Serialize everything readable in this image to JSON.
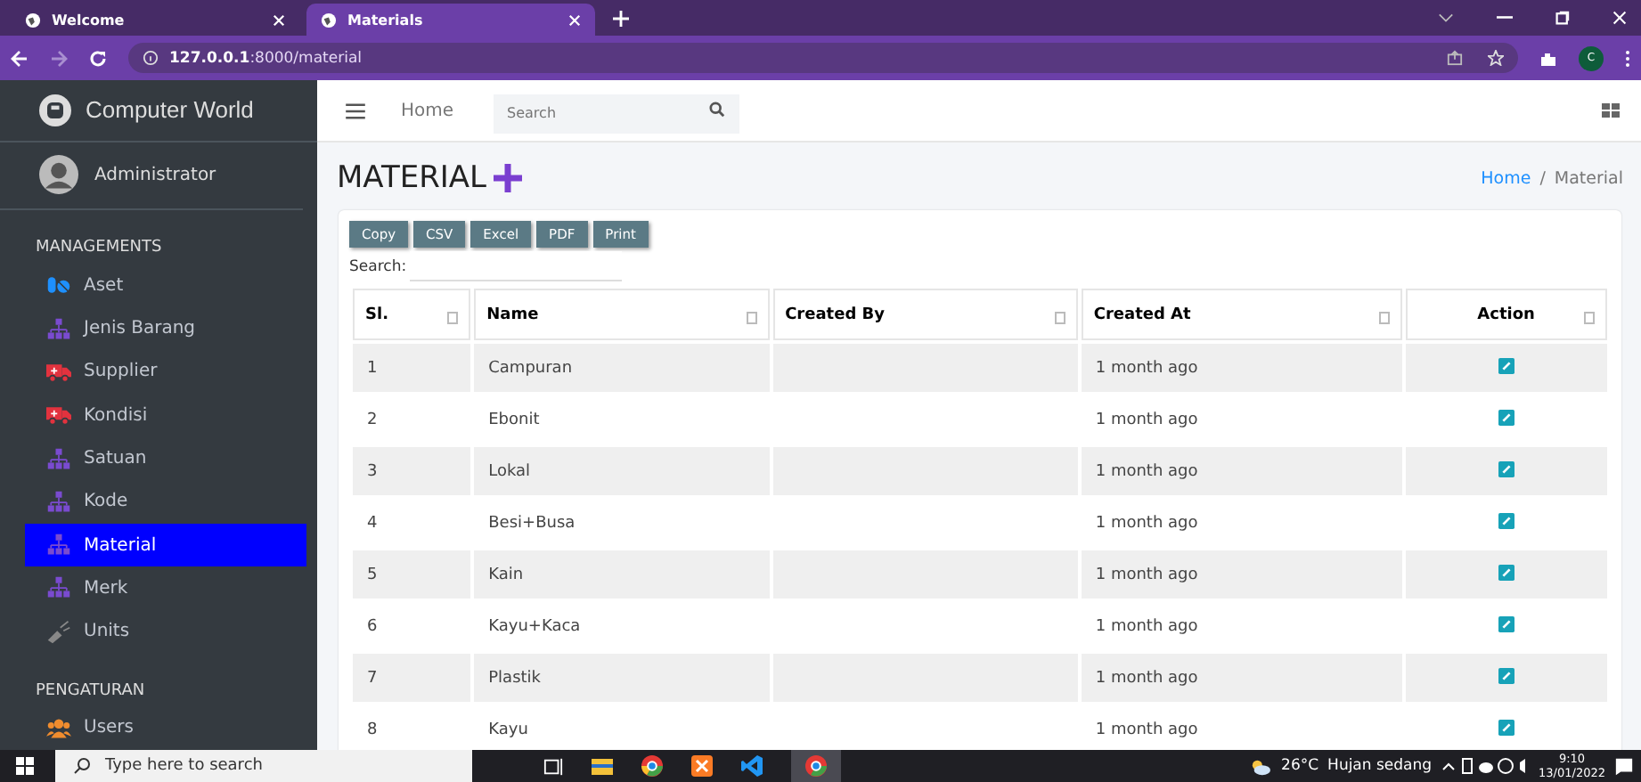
{
  "browser": {
    "tabs": [
      {
        "title": "Welcome",
        "selected": false
      },
      {
        "title": "Materials",
        "selected": true
      }
    ],
    "url": "**127.0.0.1**:8000/material",
    "profile": "C"
  },
  "sidebar": {
    "brand": "Computer World",
    "user": "Administrator",
    "sections": [
      {
        "header": "MANAGEMENTS",
        "items": [
          {
            "label": "Aset",
            "kind": "pills",
            "selected": false
          },
          {
            "label": "Jenis Barang",
            "kind": "sitemap",
            "selected": false
          },
          {
            "label": "Supplier",
            "kind": "ambulance",
            "selected": false
          },
          {
            "label": "Kondisi",
            "kind": "ambulance",
            "selected": false
          },
          {
            "label": "Satuan",
            "kind": "sitemap",
            "selected": false
          },
          {
            "label": "Kode",
            "kind": "sitemap",
            "selected": false
          },
          {
            "label": "Material",
            "kind": "sitemap",
            "selected": true
          },
          {
            "label": "Merk",
            "kind": "sitemap",
            "selected": false
          },
          {
            "label": "Units",
            "kind": "tool",
            "selected": false
          }
        ]
      },
      {
        "header": "PENGATURAN",
        "items": [
          {
            "label": "Users",
            "kind": "users",
            "selected": false
          }
        ]
      }
    ]
  },
  "topnav": {
    "home": "Home",
    "search": {
      "placeholder": "Search"
    }
  },
  "page": {
    "title": "MATERIAL",
    "breadcrumb": [
      "Home",
      "Material"
    ],
    "breadcrumb_separator": "/"
  },
  "table_tools": {
    "buttons": [
      "Copy",
      "CSV",
      "Excel",
      "PDF",
      "Print"
    ],
    "search_label": "Search:"
  },
  "table": {
    "columns": [
      "Sl.",
      "Name",
      "Created By",
      "Created At",
      "Action"
    ],
    "rows": [
      [
        "1",
        "Campuran",
        "",
        "1 month ago"
      ],
      [
        "2",
        "Ebonit",
        "",
        "1 month ago"
      ],
      [
        "3",
        "Lokal",
        "",
        "1 month ago"
      ],
      [
        "4",
        "Besi+Busa",
        "",
        "1 month ago"
      ],
      [
        "5",
        "Kain",
        "",
        "1 month ago"
      ],
      [
        "6",
        "Kayu+Kaca",
        "",
        "1 month ago"
      ],
      [
        "7",
        "Plastik",
        "",
        "1 month ago"
      ],
      [
        "8",
        "Kayu",
        "",
        "1 month ago"
      ]
    ]
  },
  "taskbar": {
    "search": {
      "placeholder": "Type here to search"
    },
    "temperature": "26°C",
    "weather": "Hujan sedang",
    "time": "9:10",
    "date": "13/01/2022"
  }
}
